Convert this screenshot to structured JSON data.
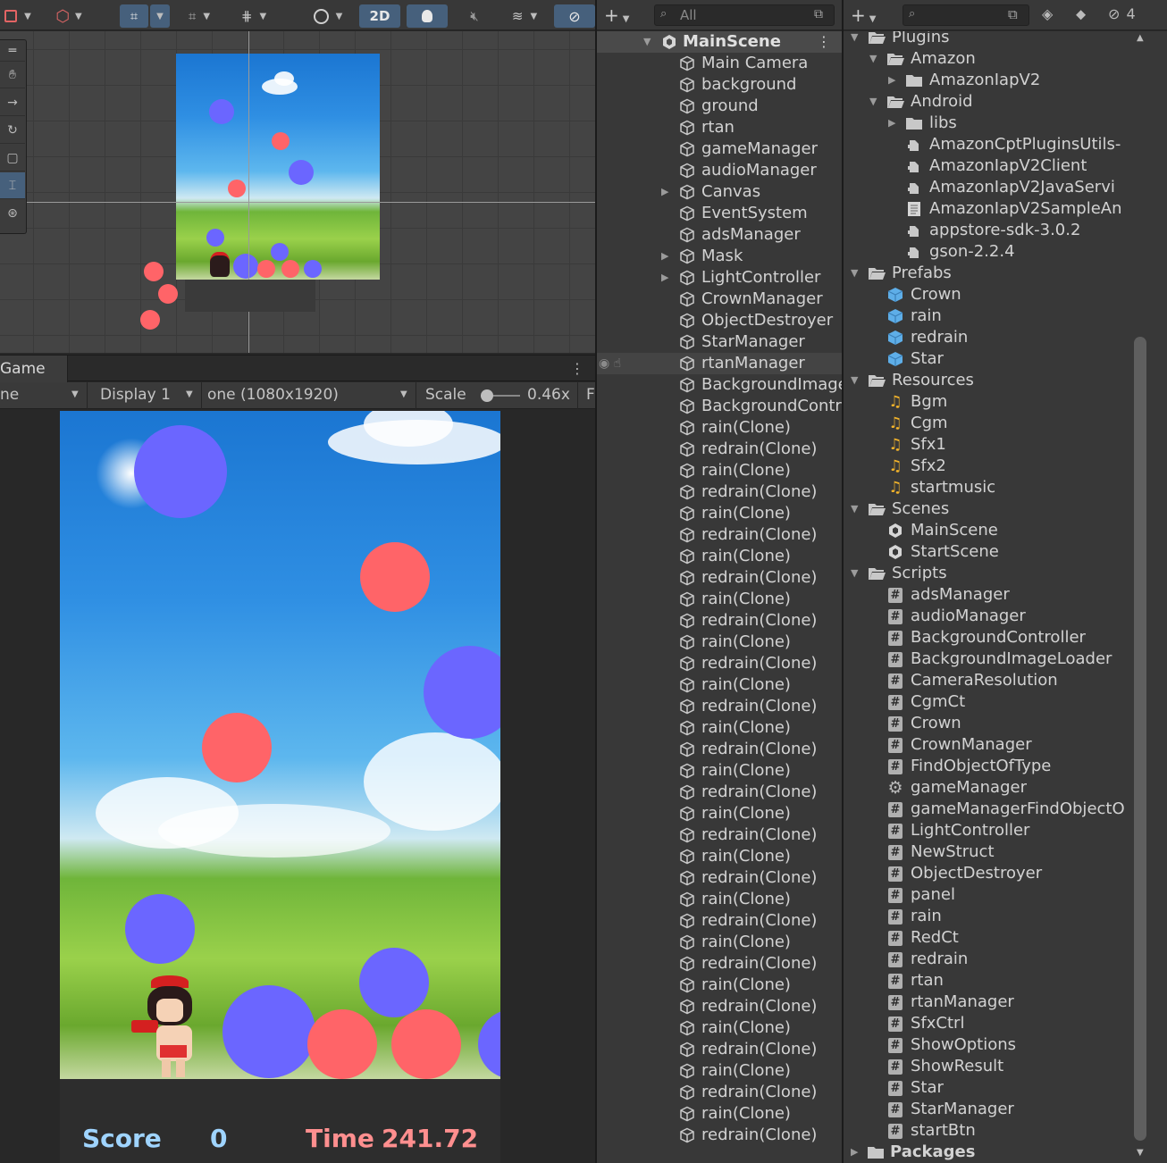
{
  "scene_toolbar": {
    "mode_2d_label": "2D"
  },
  "scene_tools": [
    "hand-icon",
    "move-icon",
    "rotate-icon",
    "scale-icon",
    "rect-icon",
    "transform-icon"
  ],
  "game_panel": {
    "tab_label": "Game",
    "view_mode_partial": "ne",
    "display_label": "Display 1",
    "resolution_label": "one (1080x1920)",
    "scale_label": "Scale",
    "scale_value": "0.46x",
    "trailing_label": "F"
  },
  "hud": {
    "score_label": "Score",
    "score_value": "0",
    "time_label": "Time",
    "time_value": "241.72"
  },
  "colors": {
    "blue_ball": "#6b66ff",
    "red_ball": "#ff6468",
    "score_label": "#9fd4ff",
    "time_label": "#ff8f8f",
    "panel_bg": "#383838"
  },
  "hierarchy": {
    "search_placeholder": "All",
    "scene_name": "MainScene",
    "items": [
      {
        "label": "Main Camera",
        "expandable": false
      },
      {
        "label": "background",
        "expandable": false
      },
      {
        "label": "ground",
        "expandable": false
      },
      {
        "label": "rtan",
        "expandable": false
      },
      {
        "label": "gameManager",
        "expandable": false
      },
      {
        "label": "audioManager",
        "expandable": false
      },
      {
        "label": "Canvas",
        "expandable": true
      },
      {
        "label": "EventSystem",
        "expandable": false
      },
      {
        "label": "adsManager",
        "expandable": false
      },
      {
        "label": "Mask",
        "expandable": true
      },
      {
        "label": "LightController",
        "expandable": true
      },
      {
        "label": "CrownManager",
        "expandable": false
      },
      {
        "label": "ObjectDestroyer",
        "expandable": false
      },
      {
        "label": "StarManager",
        "expandable": false
      },
      {
        "label": "rtanManager",
        "expandable": false,
        "hovered": true
      },
      {
        "label": "BackgroundImage",
        "expandable": false
      },
      {
        "label": "BackgroundContr",
        "expandable": false
      },
      {
        "label": "rain(Clone)",
        "expandable": false
      },
      {
        "label": "redrain(Clone)",
        "expandable": false
      },
      {
        "label": "rain(Clone)",
        "expandable": false
      },
      {
        "label": "redrain(Clone)",
        "expandable": false
      },
      {
        "label": "rain(Clone)",
        "expandable": false
      },
      {
        "label": "redrain(Clone)",
        "expandable": false
      },
      {
        "label": "rain(Clone)",
        "expandable": false
      },
      {
        "label": "redrain(Clone)",
        "expandable": false
      },
      {
        "label": "rain(Clone)",
        "expandable": false
      },
      {
        "label": "redrain(Clone)",
        "expandable": false
      },
      {
        "label": "rain(Clone)",
        "expandable": false
      },
      {
        "label": "redrain(Clone)",
        "expandable": false
      },
      {
        "label": "rain(Clone)",
        "expandable": false
      },
      {
        "label": "redrain(Clone)",
        "expandable": false
      },
      {
        "label": "rain(Clone)",
        "expandable": false
      },
      {
        "label": "redrain(Clone)",
        "expandable": false
      },
      {
        "label": "rain(Clone)",
        "expandable": false
      },
      {
        "label": "redrain(Clone)",
        "expandable": false
      },
      {
        "label": "rain(Clone)",
        "expandable": false
      },
      {
        "label": "redrain(Clone)",
        "expandable": false
      },
      {
        "label": "rain(Clone)",
        "expandable": false
      },
      {
        "label": "redrain(Clone)",
        "expandable": false
      },
      {
        "label": "rain(Clone)",
        "expandable": false
      },
      {
        "label": "redrain(Clone)",
        "expandable": false
      },
      {
        "label": "rain(Clone)",
        "expandable": false
      },
      {
        "label": "redrain(Clone)",
        "expandable": false
      },
      {
        "label": "rain(Clone)",
        "expandable": false
      },
      {
        "label": "redrain(Clone)",
        "expandable": false
      },
      {
        "label": "rain(Clone)",
        "expandable": false
      },
      {
        "label": "redrain(Clone)",
        "expandable": false
      },
      {
        "label": "rain(Clone)",
        "expandable": false
      },
      {
        "label": "redrain(Clone)",
        "expandable": false
      },
      {
        "label": "rain(Clone)",
        "expandable": false
      },
      {
        "label": "redrain(Clone)",
        "expandable": false
      }
    ]
  },
  "project": {
    "hidden_count": "4",
    "items": [
      {
        "label": "Plugins",
        "icon": "folder-open",
        "depth": 0,
        "arrow": "down"
      },
      {
        "label": "Amazon",
        "icon": "folder-open",
        "depth": 1,
        "arrow": "down"
      },
      {
        "label": "AmazonIapV2",
        "icon": "folder",
        "depth": 2,
        "arrow": "right"
      },
      {
        "label": "Android",
        "icon": "folder-open",
        "depth": 1,
        "arrow": "down"
      },
      {
        "label": "libs",
        "icon": "folder",
        "depth": 2,
        "arrow": "right"
      },
      {
        "label": "AmazonCptPluginsUtils-",
        "icon": "plugin",
        "depth": 2,
        "arrow": "none"
      },
      {
        "label": "AmazonIapV2Client",
        "icon": "plugin",
        "depth": 2,
        "arrow": "none"
      },
      {
        "label": "AmazonIapV2JavaServi",
        "icon": "plugin",
        "depth": 2,
        "arrow": "none"
      },
      {
        "label": "AmazonIapV2SampleAn",
        "icon": "text-file",
        "depth": 2,
        "arrow": "none"
      },
      {
        "label": "appstore-sdk-3.0.2",
        "icon": "plugin",
        "depth": 2,
        "arrow": "none"
      },
      {
        "label": "gson-2.2.4",
        "icon": "plugin",
        "depth": 2,
        "arrow": "none"
      },
      {
        "label": "Prefabs",
        "icon": "folder-open",
        "depth": 0,
        "arrow": "down"
      },
      {
        "label": "Crown",
        "icon": "prefab",
        "depth": 1,
        "arrow": "none"
      },
      {
        "label": "rain",
        "icon": "prefab",
        "depth": 1,
        "arrow": "none"
      },
      {
        "label": "redrain",
        "icon": "prefab",
        "depth": 1,
        "arrow": "none"
      },
      {
        "label": "Star",
        "icon": "prefab",
        "depth": 1,
        "arrow": "none"
      },
      {
        "label": "Resources",
        "icon": "folder-open",
        "depth": 0,
        "arrow": "down"
      },
      {
        "label": "Bgm",
        "icon": "audio",
        "depth": 1,
        "arrow": "none"
      },
      {
        "label": "Cgm",
        "icon": "audio",
        "depth": 1,
        "arrow": "none"
      },
      {
        "label": "Sfx1",
        "icon": "audio",
        "depth": 1,
        "arrow": "none"
      },
      {
        "label": "Sfx2",
        "icon": "audio",
        "depth": 1,
        "arrow": "none"
      },
      {
        "label": "startmusic",
        "icon": "audio",
        "depth": 1,
        "arrow": "none"
      },
      {
        "label": "Scenes",
        "icon": "folder-open",
        "depth": 0,
        "arrow": "down"
      },
      {
        "label": "MainScene",
        "icon": "unity-scene",
        "depth": 1,
        "arrow": "none"
      },
      {
        "label": "StartScene",
        "icon": "unity-scene",
        "depth": 1,
        "arrow": "none"
      },
      {
        "label": "Scripts",
        "icon": "folder-open",
        "depth": 0,
        "arrow": "down"
      },
      {
        "label": "adsManager",
        "icon": "csharp",
        "depth": 1,
        "arrow": "none"
      },
      {
        "label": "audioManager",
        "icon": "csharp",
        "depth": 1,
        "arrow": "none"
      },
      {
        "label": "BackgroundController",
        "icon": "csharp",
        "depth": 1,
        "arrow": "none"
      },
      {
        "label": "BackgroundImageLoader",
        "icon": "csharp",
        "depth": 1,
        "arrow": "none"
      },
      {
        "label": "CameraResolution",
        "icon": "csharp",
        "depth": 1,
        "arrow": "none"
      },
      {
        "label": "CgmCt",
        "icon": "csharp",
        "depth": 1,
        "arrow": "none"
      },
      {
        "label": "Crown",
        "icon": "csharp",
        "depth": 1,
        "arrow": "none"
      },
      {
        "label": "CrownManager",
        "icon": "csharp",
        "depth": 1,
        "arrow": "none"
      },
      {
        "label": "FindObjectOfType",
        "icon": "csharp",
        "depth": 1,
        "arrow": "none"
      },
      {
        "label": "gameManager",
        "icon": "gear",
        "depth": 1,
        "arrow": "none"
      },
      {
        "label": "gameManagerFindObjectO",
        "icon": "csharp",
        "depth": 1,
        "arrow": "none"
      },
      {
        "label": "LightController",
        "icon": "csharp",
        "depth": 1,
        "arrow": "none"
      },
      {
        "label": "NewStruct",
        "icon": "csharp",
        "depth": 1,
        "arrow": "none"
      },
      {
        "label": "ObjectDestroyer",
        "icon": "csharp",
        "depth": 1,
        "arrow": "none"
      },
      {
        "label": "panel",
        "icon": "csharp",
        "depth": 1,
        "arrow": "none"
      },
      {
        "label": "rain",
        "icon": "csharp",
        "depth": 1,
        "arrow": "none"
      },
      {
        "label": "RedCt",
        "icon": "csharp",
        "depth": 1,
        "arrow": "none"
      },
      {
        "label": "redrain",
        "icon": "csharp",
        "depth": 1,
        "arrow": "none"
      },
      {
        "label": "rtan",
        "icon": "csharp",
        "depth": 1,
        "arrow": "none"
      },
      {
        "label": "rtanManager",
        "icon": "csharp",
        "depth": 1,
        "arrow": "none"
      },
      {
        "label": "SfxCtrl",
        "icon": "csharp",
        "depth": 1,
        "arrow": "none"
      },
      {
        "label": "ShowOptions",
        "icon": "csharp",
        "depth": 1,
        "arrow": "none"
      },
      {
        "label": "ShowResult",
        "icon": "csharp",
        "depth": 1,
        "arrow": "none"
      },
      {
        "label": "Star",
        "icon": "csharp",
        "depth": 1,
        "arrow": "none"
      },
      {
        "label": "StarManager",
        "icon": "csharp",
        "depth": 1,
        "arrow": "none"
      },
      {
        "label": "startBtn",
        "icon": "csharp",
        "depth": 1,
        "arrow": "none"
      }
    ],
    "packages_label": "Packages"
  }
}
